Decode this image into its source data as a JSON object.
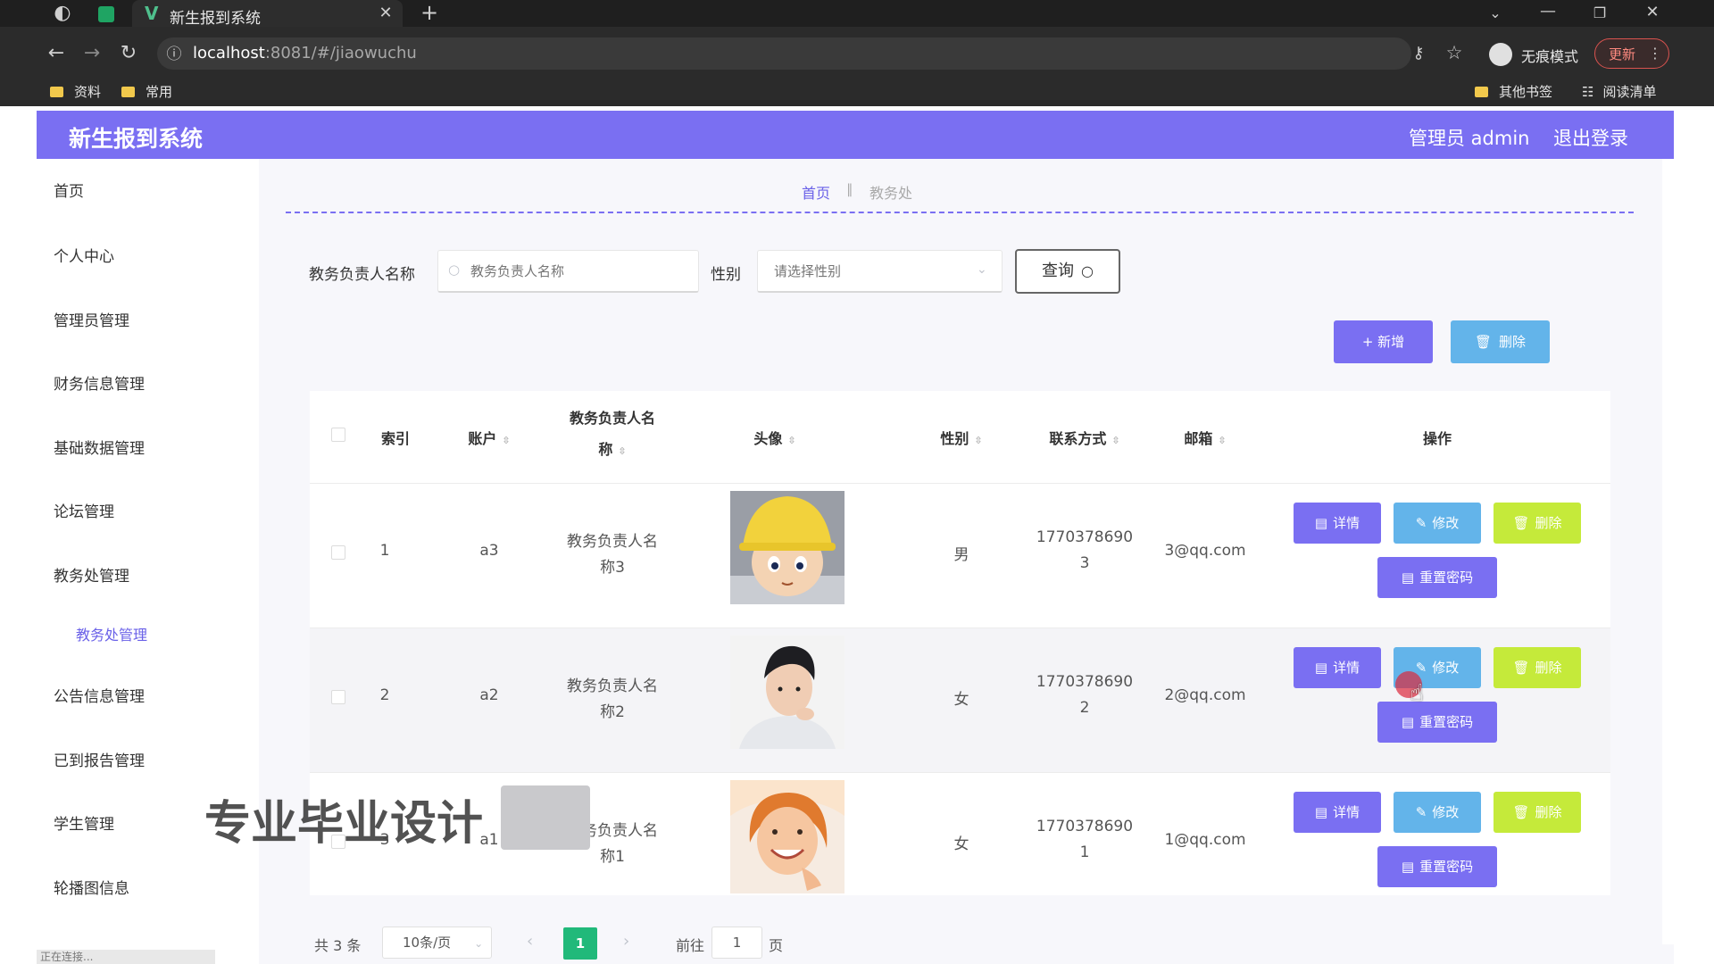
{
  "browser": {
    "tab_title": "新生报到系统",
    "url_host": "localhost",
    "url_rest": ":8081/#/jiaowuchu",
    "incognito_label": "无痕模式",
    "update_label": "更新",
    "bookmarks": [
      "资料",
      "常用"
    ],
    "other_bookmarks": "其他书签",
    "reading_list": "阅读清单"
  },
  "app": {
    "title": "新生报到系统",
    "admin": "管理员 admin",
    "logout": "退出登录"
  },
  "sidebar": {
    "items": [
      "首页",
      "个人中心",
      "管理员管理",
      "财务信息管理",
      "基础数据管理",
      "论坛管理",
      "教务处管理",
      "公告信息管理",
      "已到报告管理",
      "学生管理",
      "轮播图信息"
    ],
    "sub_item": "教务处管理"
  },
  "breadcrumb": {
    "home": "首页",
    "current": "教务处"
  },
  "search": {
    "name_label": "教务负责人名称",
    "name_placeholder": "教务负责人名称",
    "gender_label": "性别",
    "gender_placeholder": "请选择性别",
    "query_button": "查询"
  },
  "toolbar": {
    "add": "+ 新增",
    "delete": "删除"
  },
  "table": {
    "headers": {
      "index": "索引",
      "account": "账户",
      "name_line1": "教务负责人名",
      "name_line2": "称",
      "avatar": "头像",
      "gender": "性别",
      "phone": "联系方式",
      "email": "邮箱",
      "actions": "操作"
    },
    "action_labels": {
      "detail": "详情",
      "edit": "修改",
      "delete": "删除",
      "reset": "重置密码"
    },
    "rows": [
      {
        "index": "1",
        "account": "a3",
        "name_line1": "教务负责人名",
        "name_line2": "称3",
        "gender": "男",
        "phone_line1": "1770378690",
        "phone_line2": "3",
        "email": "3@qq.com"
      },
      {
        "index": "2",
        "account": "a2",
        "name_line1": "教务负责人名",
        "name_line2": "称2",
        "gender": "女",
        "phone_line1": "1770378690",
        "phone_line2": "2",
        "email": "2@qq.com"
      },
      {
        "index": "3",
        "account": "a1",
        "name_line1": "教务负责人名",
        "name_line2": "称1",
        "gender": "女",
        "phone_line1": "1770378690",
        "phone_line2": "1",
        "email": "1@qq.com"
      }
    ]
  },
  "pagination": {
    "total": "共 3 条",
    "page_size": "10条/页",
    "current_page": "1",
    "goto_prefix": "前往",
    "goto_value": "1",
    "goto_suffix": "页"
  },
  "overlay": {
    "watermark": "专业毕业设计",
    "status_strip": "正在连接..."
  },
  "colors": {
    "primary": "#7a6ff2",
    "info": "#63b4ea",
    "lime": "#c5ea3a",
    "page_active": "#21b97a"
  }
}
